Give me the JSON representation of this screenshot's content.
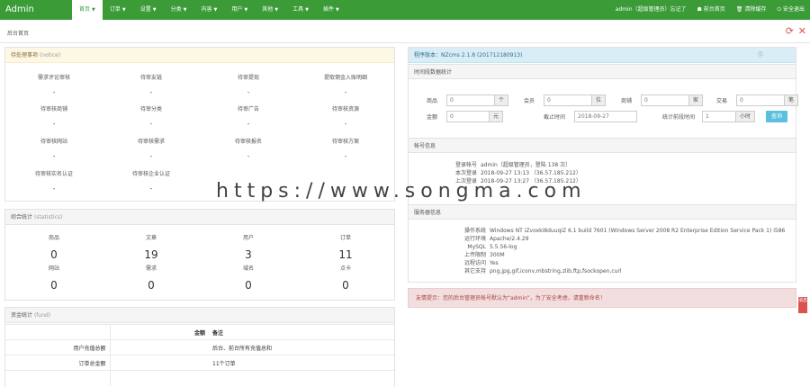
{
  "app": {
    "logo": "Admin",
    "breadcrumb": "后台首页"
  },
  "nav": [
    {
      "label": "首页",
      "active": true
    },
    {
      "label": "订单",
      "active": false
    },
    {
      "label": "设置",
      "active": false
    },
    {
      "label": "分类",
      "active": false
    },
    {
      "label": "内容",
      "active": false
    },
    {
      "label": "用户",
      "active": false
    },
    {
      "label": "其他",
      "active": false
    },
    {
      "label": "工具",
      "active": false
    },
    {
      "label": "插件",
      "active": false
    }
  ],
  "top_right": {
    "user": "admin（超级管理员）忘记了",
    "home": "☗ 前台首页",
    "cache": "🗑 清除缓存",
    "logout": "⏻ 安全退出"
  },
  "todo": {
    "title": "待处理事项",
    "subtitle": "(notice)",
    "items": [
      {
        "label": "需求评论审核",
        "value": "-"
      },
      {
        "label": "待审友链",
        "value": "-"
      },
      {
        "label": "待审提现",
        "value": "-"
      },
      {
        "label": "提取佣金入账明细",
        "value": "-"
      },
      {
        "label": "待审核商铺",
        "value": "-"
      },
      {
        "label": "待审分类",
        "value": "-"
      },
      {
        "label": "待审广告",
        "value": "-"
      },
      {
        "label": "待审核资源",
        "value": "-"
      },
      {
        "label": "待审核网站",
        "value": "-"
      },
      {
        "label": "待审核需求",
        "value": "-"
      },
      {
        "label": "待审核报名",
        "value": "-"
      },
      {
        "label": "待审核方案",
        "value": "-"
      },
      {
        "label": "待审核实名认证",
        "value": "-"
      },
      {
        "label": "待审核企业认证",
        "value": "-"
      }
    ]
  },
  "stats": {
    "title": "综合统计",
    "subtitle": "(statistics)",
    "items": [
      {
        "label": "商品",
        "value": "0"
      },
      {
        "label": "文章",
        "value": "19"
      },
      {
        "label": "用户",
        "value": "3"
      },
      {
        "label": "订单",
        "value": "11"
      },
      {
        "label": "网站",
        "value": "0"
      },
      {
        "label": "需求",
        "value": "0"
      },
      {
        "label": "域名",
        "value": "0"
      },
      {
        "label": "点卡",
        "value": "0"
      }
    ]
  },
  "funds": {
    "title": "资金统计",
    "subtitle": "(fund)",
    "headers": [
      "",
      "金额",
      "备注"
    ],
    "rows": [
      {
        "name": "用户充值总额",
        "amount": "",
        "note": "后台、前台所有充值总和"
      },
      {
        "name": "订单总金额",
        "amount": "",
        "note": "11个订单"
      }
    ]
  },
  "version": {
    "label": "程序版本：NZcms 2.1.8 (20171218091​3)"
  },
  "timeStats": {
    "title": "时间段数据统计",
    "fields": [
      {
        "label": "商品",
        "value": "0",
        "unit": "个"
      },
      {
        "label": "会员",
        "value": "0",
        "unit": "位"
      },
      {
        "label": "商铺",
        "value": "0",
        "unit": "家"
      },
      {
        "label": "交易",
        "value": "0",
        "unit": "笔"
      }
    ],
    "amount": {
      "label": "金额",
      "value": "0",
      "unit": "元"
    },
    "startTime": {
      "label": "截止时间",
      "value": "2018-09-27"
    },
    "hours": {
      "label": "统计前段时间",
      "value": "1",
      "unit": "小时"
    },
    "query": "查询"
  },
  "account": {
    "title": "帐号信息",
    "rows": [
      {
        "key": "登录帐号",
        "value": "admin（超级管理员，登陆 138 次）"
      },
      {
        "key": "本次登录",
        "value": "2018-09-27 13:13 （36.57.185.212）"
      },
      {
        "key": "上次登录",
        "value": "2018-09-27 13:27 （36.57.185.212）"
      }
    ]
  },
  "server": {
    "title": "服务器信息",
    "rows": [
      {
        "key": "操作系统",
        "value": "Windows NT iZvoxki8duuqiZ 6.1 build 7601 (Windows Server 2008 R2 Enterprise Edition Service Pack 1) i586"
      },
      {
        "key": "运行环境",
        "value": "Apache/2.4.29"
      },
      {
        "key": "MySQL",
        "value": "5.5.56-log"
      },
      {
        "key": "上传限制",
        "value": "300M"
      },
      {
        "key": "远程访问",
        "value": "Yes"
      },
      {
        "key": "其它支持",
        "value": "png,jpg,gif,iconv,mbstring,zlib,ftp,fsockopen,curl"
      }
    ]
  },
  "alert": {
    "text": "友情提示：您的后台管理员帐号默认为“admin”，为了安全考虑，请重新命名！"
  },
  "side_tag": "消息",
  "watermark": "https://www.songma.com"
}
